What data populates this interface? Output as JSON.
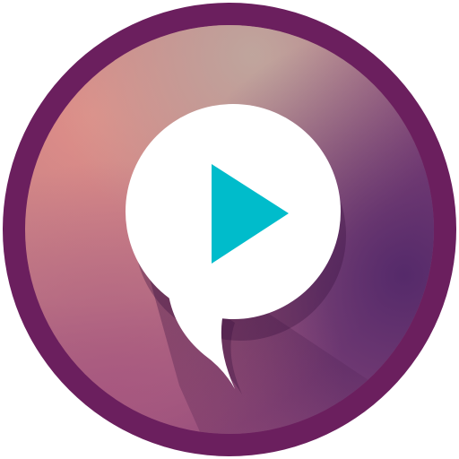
{
  "icon": {
    "name": "video-chat-app-icon",
    "glyph": "play-icon",
    "bubble": "speech-bubble-icon"
  },
  "colors": {
    "ring": "#6b1f5e",
    "gradient_top_left": "#e08f88",
    "gradient_top_center": "#b9a49d",
    "gradient_right": "#5e2f6c",
    "gradient_bottom_left": "#a35a82",
    "bubble": "#ffffff",
    "play": "#00bccb",
    "shadow": "#3a1040"
  }
}
